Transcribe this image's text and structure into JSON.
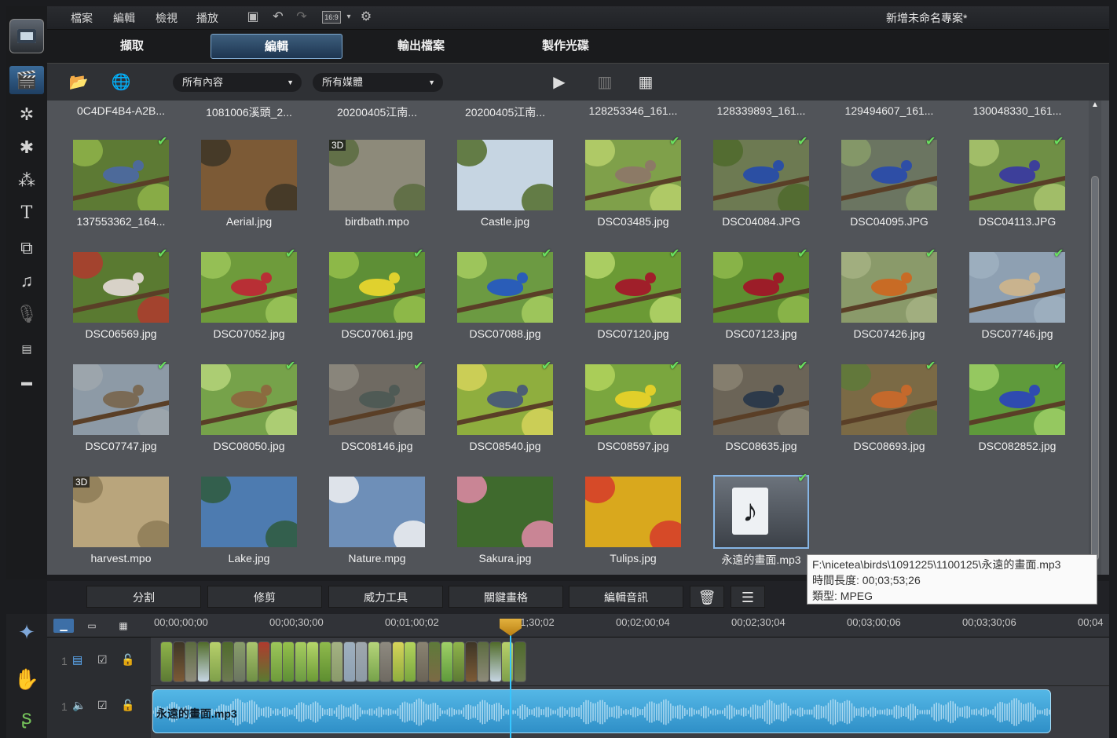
{
  "menu": {
    "items": [
      "檔案",
      "編輯",
      "檢視",
      "播放"
    ],
    "aspect": "16:9",
    "project_title": "新增未命名專案*"
  },
  "modes": [
    "擷取",
    "編輯",
    "輸出檔案",
    "製作光碟"
  ],
  "library": {
    "filter_content": "所有內容",
    "filter_media": "所有媒體",
    "top_labels": [
      "0C4DF4B4-A2B...",
      "1081006溪頭_2...",
      "20200405江南...",
      "20200405江南...",
      "128253346_161...",
      "128339893_161...",
      "129494607_161...",
      "130048330_161..."
    ],
    "items": [
      {
        "label": "137553362_164...",
        "check": true,
        "tag": "",
        "sky": "#5d7a34",
        "bird": "#4d6a9a",
        "leaf": "#8fb44a"
      },
      {
        "label": "Aerial.jpg",
        "check": false,
        "tag": "",
        "sky": "#7c5a36",
        "bird": "",
        "leaf": "#3d3526"
      },
      {
        "label": "birdbath.mpo",
        "check": false,
        "tag": "3D",
        "sky": "#8d8a7a",
        "bird": "",
        "leaf": "#5b6b3f"
      },
      {
        "label": "Castle.jpg",
        "check": false,
        "tag": "",
        "sky": "#c6d5e2",
        "bird": "",
        "leaf": "#516c2a"
      },
      {
        "label": "DSC03485.jpg",
        "check": true,
        "tag": "",
        "sky": "#7fa04a",
        "bird": "#8c7a66",
        "leaf": "#b7d06b"
      },
      {
        "label": "DSC04084.JPG",
        "check": true,
        "tag": "",
        "sky": "#6d7a52",
        "bird": "#2b4fa3",
        "leaf": "#4f6a2c"
      },
      {
        "label": "DSC04095.JPG",
        "check": true,
        "tag": "",
        "sky": "#6b7561",
        "bird": "#2e4ea6",
        "leaf": "#889d6a"
      },
      {
        "label": "DSC04113.JPG",
        "check": true,
        "tag": "",
        "sky": "#6f8f45",
        "bird": "#3d3f9a",
        "leaf": "#aac56e"
      },
      {
        "label": "DSC06569.jpg",
        "check": true,
        "tag": "",
        "sky": "#5a7a31",
        "bird": "#d8d2c8",
        "leaf": "#b03a2e"
      },
      {
        "label": "DSC07052.jpg",
        "check": true,
        "tag": "",
        "sky": "#6e9b3b",
        "bird": "#b82f35",
        "leaf": "#9cc65a"
      },
      {
        "label": "DSC07061.jpg",
        "check": true,
        "tag": "",
        "sky": "#5e8f36",
        "bird": "#e0d12e",
        "leaf": "#95c04b"
      },
      {
        "label": "DSC07088.jpg",
        "check": true,
        "tag": "",
        "sky": "#6c9a42",
        "bird": "#2a5db8",
        "leaf": "#a6cd5f"
      },
      {
        "label": "DSC07120.jpg",
        "check": true,
        "tag": "",
        "sky": "#6b9a35",
        "bird": "#a01f2a",
        "leaf": "#b5d66a"
      },
      {
        "label": "DSC07123.jpg",
        "check": true,
        "tag": "",
        "sky": "#5e8e30",
        "bird": "#9c1d28",
        "leaf": "#8fba4c"
      },
      {
        "label": "DSC07426.jpg",
        "check": true,
        "tag": "",
        "sky": "#8a9a6a",
        "bird": "#c86b25",
        "leaf": "#a4b283"
      },
      {
        "label": "DSC07746.jpg",
        "check": true,
        "tag": "",
        "sky": "#8ea0b2",
        "bird": "#c9b38e",
        "leaf": "#9fb0bf"
      },
      {
        "label": "DSC07747.jpg",
        "check": true,
        "tag": "",
        "sky": "#8d9aa6",
        "bird": "#7a6a55",
        "leaf": "#9fa7ad"
      },
      {
        "label": "DSC08050.jpg",
        "check": true,
        "tag": "",
        "sky": "#76a24a",
        "bird": "#8b6b3f",
        "leaf": "#b6d57a"
      },
      {
        "label": "DSC08146.jpg",
        "check": true,
        "tag": "",
        "sky": "#6f6a62",
        "bird": "#4f5a55",
        "leaf": "#8e8a80"
      },
      {
        "label": "DSC08540.jpg",
        "check": true,
        "tag": "",
        "sky": "#8fae3e",
        "bird": "#4c5e74",
        "leaf": "#d6d45a"
      },
      {
        "label": "DSC08597.jpg",
        "check": true,
        "tag": "",
        "sky": "#7aa63e",
        "bird": "#e1cf2a",
        "leaf": "#b3d35d"
      },
      {
        "label": "DSC08635.jpg",
        "check": true,
        "tag": "",
        "sky": "#6b6457",
        "bird": "#2d3a4a",
        "leaf": "#8a8372"
      },
      {
        "label": "DSC08693.jpg",
        "check": true,
        "tag": "",
        "sky": "#7b6a45",
        "bird": "#c4692c",
        "leaf": "#5e7a3a"
      },
      {
        "label": "DSC082852.jpg",
        "check": true,
        "tag": "",
        "sky": "#5f9a3b",
        "bird": "#2f4bb0",
        "leaf": "#9fd067"
      },
      {
        "label": "harvest.mpo",
        "check": false,
        "tag": "3D",
        "sky": "#b9a57c",
        "bird": "",
        "leaf": "#8d7b57"
      },
      {
        "label": "Lake.jpg",
        "check": false,
        "tag": "",
        "sky": "#4d7bb0",
        "bird": "",
        "leaf": "#2f5a3c"
      },
      {
        "label": "Nature.mpg",
        "check": false,
        "tag": "",
        "sky": "#6e8fb8",
        "bird": "",
        "leaf": "#f2f2f2"
      },
      {
        "label": "Sakura.jpg",
        "check": false,
        "tag": "",
        "sky": "#3f6a2d",
        "bird": "",
        "leaf": "#e28aa8"
      },
      {
        "label": "Tulips.jpg",
        "check": false,
        "tag": "",
        "sky": "#d9a81d",
        "bird": "",
        "leaf": "#d53a2a"
      },
      {
        "label": "永遠的畫面.mp3",
        "check": true,
        "tag": "",
        "sky": "",
        "bird": "",
        "leaf": ""
      }
    ]
  },
  "tooltip": {
    "path": "F:\\nicetea\\birds\\1091225\\1100125\\永遠的畫面.mp3",
    "duration": "時間長度: 00;03;53;26",
    "type": "類型: MPEG"
  },
  "edit_buttons": [
    "分割",
    "修剪",
    "威力工具",
    "關鍵畫格",
    "編輯音訊"
  ],
  "timeline": {
    "ruler": [
      "00;00;00;00",
      "00;00;30;00",
      "00;01;00;02",
      "00;01;30;02",
      "00;02;00;04",
      "00;02;30;04",
      "00;03;00;06",
      "00;03;30;06",
      "00;04"
    ],
    "video_track_number": "1",
    "audio_track_number": "1",
    "audio_clip_name": "永遠的畫面.mp3"
  }
}
